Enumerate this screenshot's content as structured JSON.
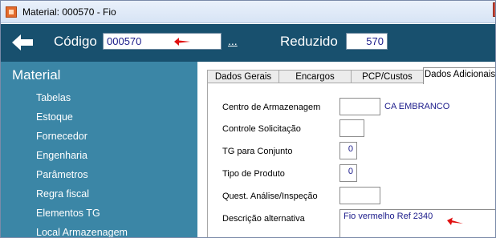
{
  "window": {
    "title": "Material: 000570 - Fio"
  },
  "header": {
    "codigo_label": "Código",
    "codigo_value": "000570",
    "lookup_label": "...",
    "reduzido_label": "Reduzido",
    "reduzido_value": "570"
  },
  "sidebar": {
    "title": "Material",
    "items": [
      {
        "label": "Tabelas"
      },
      {
        "label": "Estoque"
      },
      {
        "label": "Fornecedor"
      },
      {
        "label": "Engenharia"
      },
      {
        "label": "Parâmetros"
      },
      {
        "label": "Regra fiscal"
      },
      {
        "label": "Elementos TG"
      },
      {
        "label": "Local Armazenagem"
      }
    ]
  },
  "tabs": [
    {
      "label": "Dados Gerais"
    },
    {
      "label": "Encargos"
    },
    {
      "label": "PCP/Custos"
    },
    {
      "label": "Dados Adicionais"
    }
  ],
  "form": {
    "centro_label": "Centro de Armazenagem",
    "centro_value": "",
    "centro_desc": "CA EMBRANCO",
    "controle_label": "Controle Solicitação",
    "controle_value": "",
    "tg_label": "TG para Conjunto",
    "tg_value": "0",
    "tipo_label": "Tipo de Produto",
    "tipo_value": "0",
    "quest_label": "Quest. Análise/Inspeção",
    "quest_value": "",
    "descricao_label": "Descrição alternativa",
    "descricao_value": "Fio vermelho Ref 2340"
  },
  "colors": {
    "header_bg": "#18506e",
    "sidebar_bg": "#3b86a6",
    "annotation_arrow": "#e01010",
    "value_text": "#1a1a8a"
  }
}
